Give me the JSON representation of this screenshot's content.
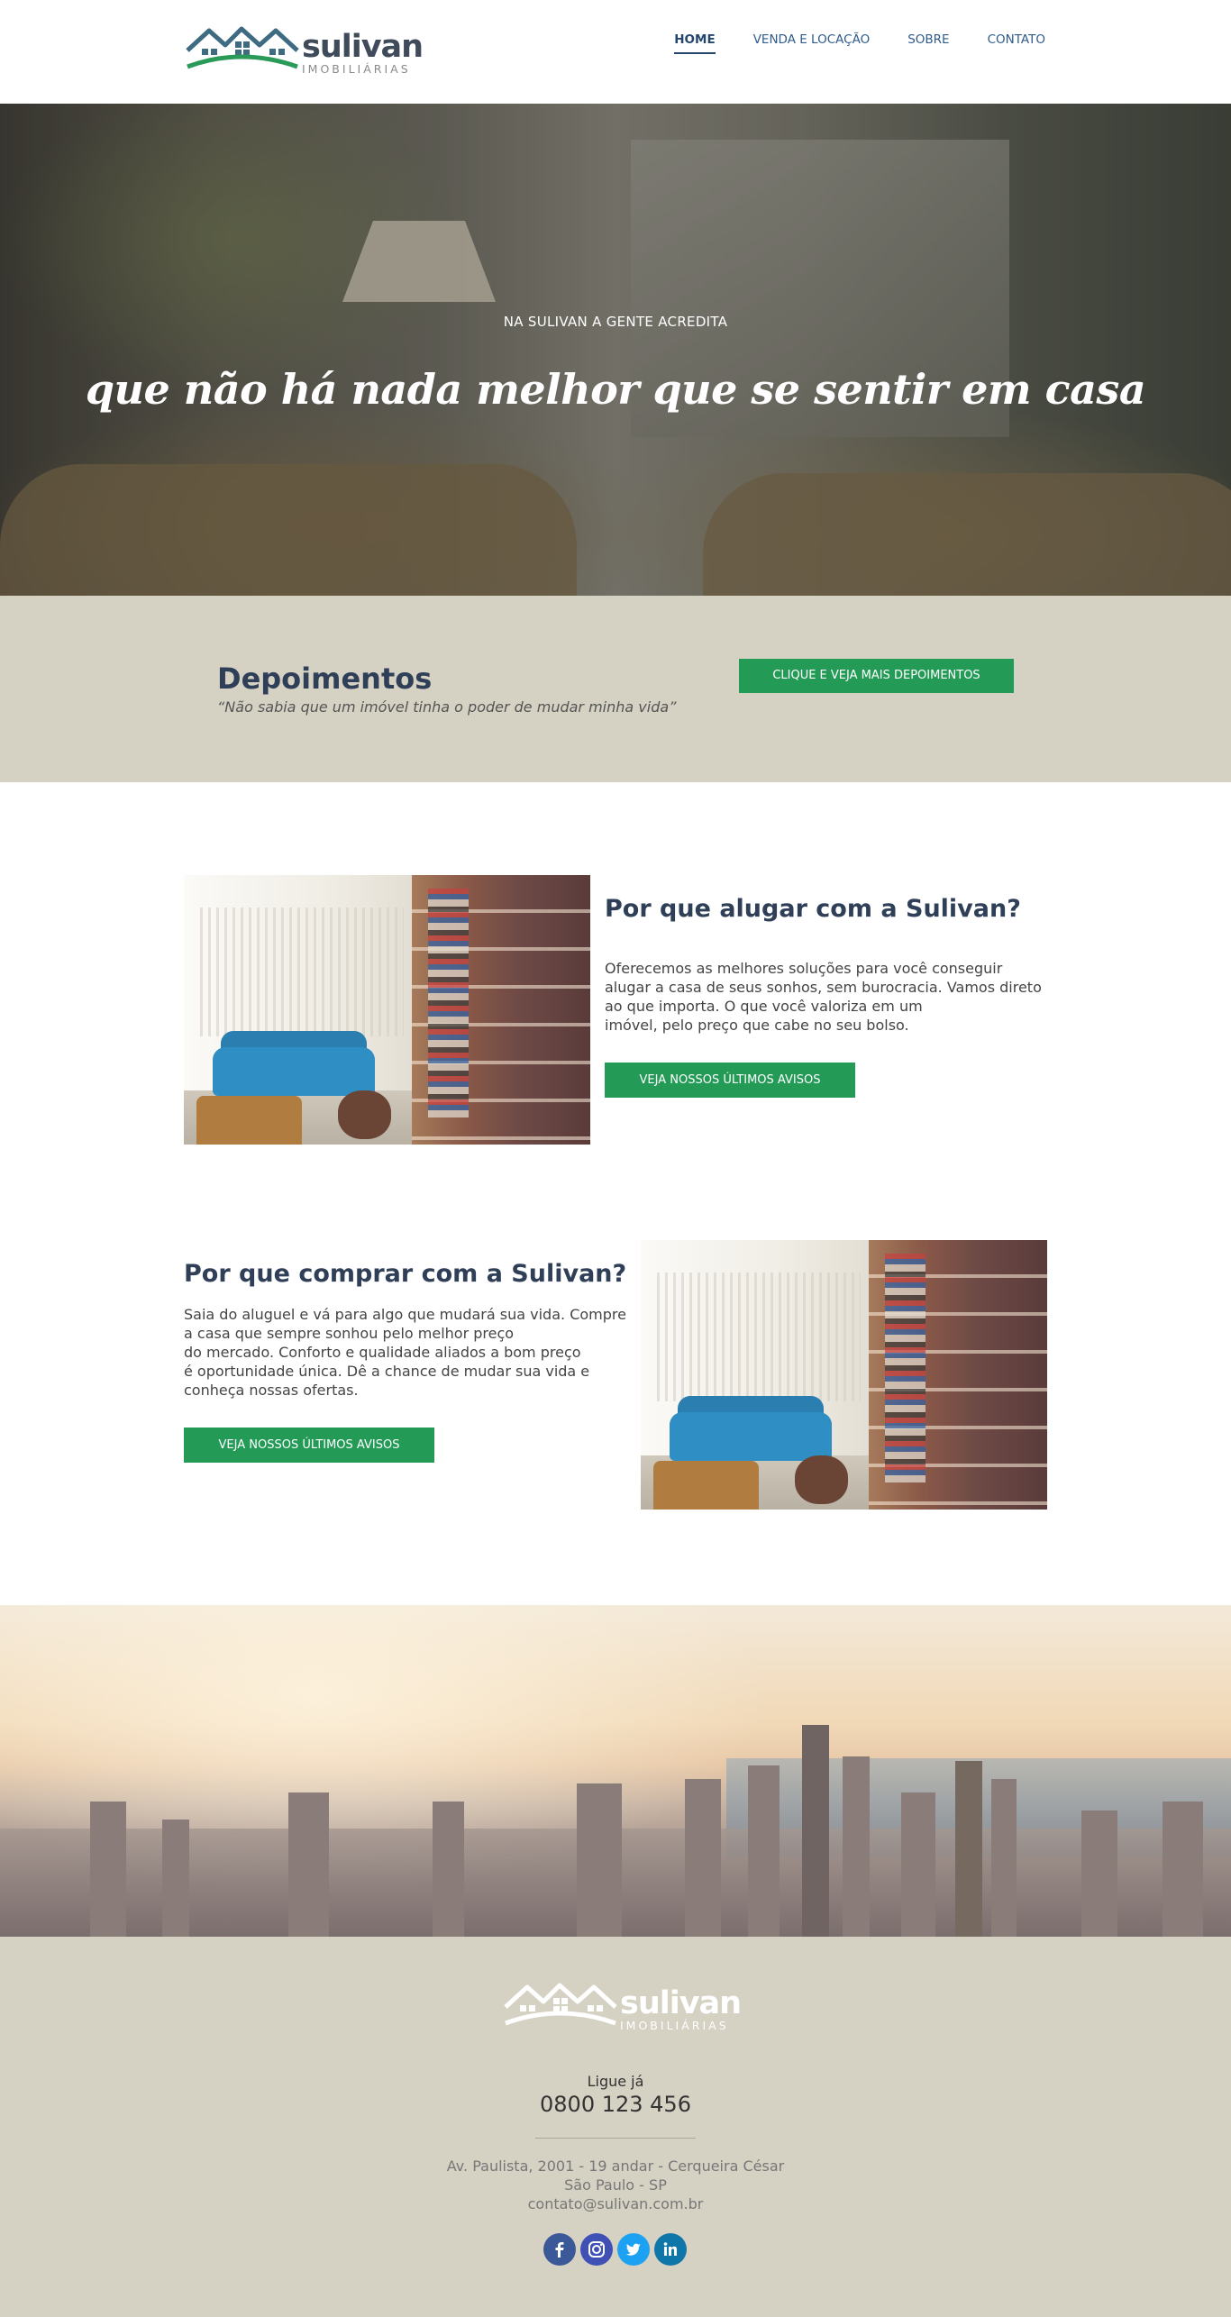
{
  "header": {
    "logo": {
      "name": "sulivan",
      "subtitle": "IMOBILIÁRIAS"
    },
    "nav": [
      {
        "label": "HOME",
        "active": true
      },
      {
        "label": "VENDA E LOCAÇÃO",
        "active": false
      },
      {
        "label": "SOBRE",
        "active": false
      },
      {
        "label": "CONTATO",
        "active": false
      }
    ]
  },
  "hero": {
    "kicker": "NA SULIVAN A GENTE ACREDITA",
    "headline": "que não há nada melhor que se sentir em casa"
  },
  "testimonials": {
    "title": "Depoimentos",
    "quote": "“Não sabia que um imóvel tinha o poder de mudar minha vida”",
    "button": "CLIQUE E VEJA MAIS DEPOIMENTOS"
  },
  "rent": {
    "title_pre": "Por que ",
    "title_bold": "alugar",
    "title_post": " com a Sulivan?",
    "text_lines": [
      "Oferecemos as melhores soluções para você conseguir",
      "alugar a casa de seus sonhos, sem burocracia. Vamos direto",
      "ao que importa. O que você valoriza em um",
      "imóvel, pelo preço que cabe no seu bolso."
    ],
    "button": "VEJA NOSSOS ÚLTIMOS AVISOS"
  },
  "buy": {
    "title_pre": "Por que ",
    "title_bold": "comprar",
    "title_post": " com a Sulivan?",
    "text_lines": [
      "Saia do aluguel e vá para algo que mudará sua vida. Compre",
      "a casa que sempre sonhou pelo melhor preço",
      "do mercado. Conforto e qualidade aliados a bom preço",
      "é oportunidade única. Dê a chance de mudar sua vida e",
      "conheça nossas ofertas."
    ],
    "button": "VEJA NOSSOS ÚLTIMOS AVISOS"
  },
  "footer": {
    "logo": {
      "name": "sulivan",
      "subtitle": "IMOBILIÁRIAS"
    },
    "call_label": "Ligue já",
    "phone": "0800 123 456",
    "address_lines": [
      "Av. Paulista, 2001 - 19 andar - Cerqueira César",
      "São Paulo - SP",
      "contato@sulivan.com.br"
    ],
    "social": [
      {
        "icon": "facebook-icon",
        "color": "#3b5998"
      },
      {
        "icon": "instagram-icon",
        "color": "#3f51b5"
      },
      {
        "icon": "twitter-icon",
        "color": "#1da1f2"
      },
      {
        "icon": "linkedin-icon",
        "color": "#0e76a8"
      }
    ]
  },
  "colors": {
    "accent": "#239b57",
    "navy": "#2f3f57",
    "beige": "#d5d1c3"
  }
}
